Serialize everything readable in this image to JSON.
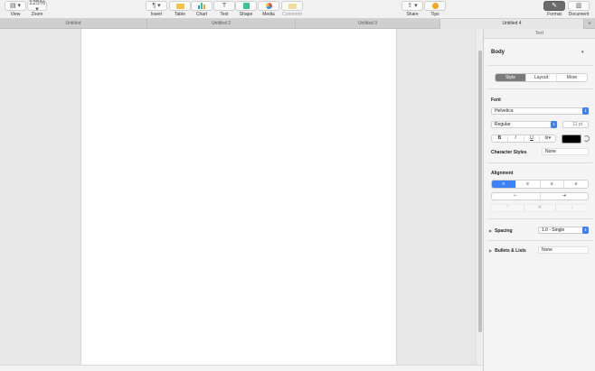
{
  "toolbar": {
    "view": {
      "label": "View",
      "glyph": "▤ ▾"
    },
    "zoom": {
      "label": "Zoom",
      "value": "125% ▾"
    },
    "insert": {
      "label": "Insert",
      "glyph": "¶ ▾"
    },
    "table": {
      "label": "Table"
    },
    "chart": {
      "label": "Chart"
    },
    "text": {
      "label": "Text",
      "glyph": "T"
    },
    "shape": {
      "label": "Shape"
    },
    "media": {
      "label": "Media"
    },
    "comment": {
      "label": "Comment"
    },
    "share": {
      "label": "Share",
      "glyph": "⇪ ▾"
    },
    "tips": {
      "label": "Tips"
    },
    "format": {
      "label": "Format",
      "glyph": "✎"
    },
    "document": {
      "label": "Document",
      "glyph": "▥"
    }
  },
  "tabs": [
    {
      "label": "Untitled"
    },
    {
      "label": "Untitled 2"
    },
    {
      "label": "Untitled 3"
    },
    {
      "label": "Untitled 4"
    }
  ],
  "tab_add": "+",
  "inspector": {
    "title": "Text",
    "paragraph_style": "Body",
    "paragraph_style_chevron": "▾",
    "segments": [
      "Style",
      "Layout",
      "More"
    ],
    "font": {
      "heading": "Font",
      "family": "Helvetica",
      "typeface": "Regular",
      "size": "11 pt",
      "bold": "B",
      "italic": "I",
      "underline": "U",
      "more_options": "⚙▾",
      "text_color": "#000000"
    },
    "character_styles": {
      "heading": "Character Styles",
      "value": "None"
    },
    "alignment": {
      "heading": "Alignment",
      "buttons": [
        "≡",
        "≡",
        "≡",
        "≡"
      ],
      "indent": [
        "⇤",
        "⇥"
      ],
      "valign": [
        "⊤",
        "✥",
        "⊥"
      ]
    },
    "spacing": {
      "heading": "Spacing",
      "value": "1.0 - Single"
    },
    "bullets": {
      "heading": "Bullets & Lists",
      "value": "None"
    },
    "disclosure": "▶"
  },
  "colors": {
    "accent": "#3d82f4",
    "toolbar_bg": "#f1f1f1",
    "page": "#ffffff"
  }
}
